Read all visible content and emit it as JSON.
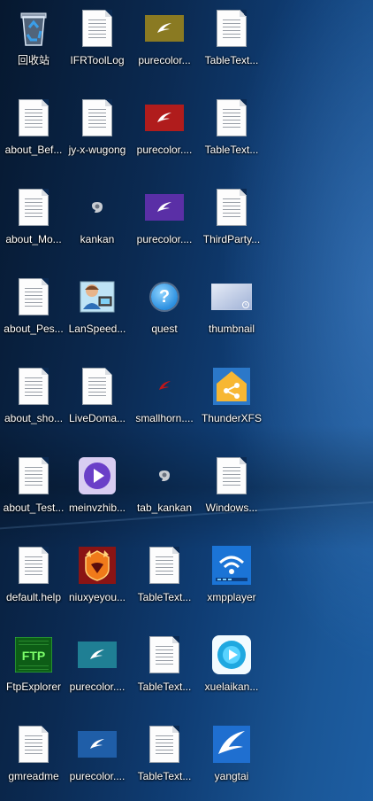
{
  "desktop": {
    "icons": [
      {
        "label": "回收站",
        "icon": "recycle-bin-icon"
      },
      {
        "label": "IFRToolLog",
        "icon": "document-icon"
      },
      {
        "label": "purecolor...",
        "icon": "purecolor-olive-icon"
      },
      {
        "label": "TableText...",
        "icon": "document-icon"
      },
      {
        "label": "about_Bef...",
        "icon": "document-icon"
      },
      {
        "label": "jy-x-wugong",
        "icon": "document-icon"
      },
      {
        "label": "purecolor....",
        "icon": "purecolor-red-icon"
      },
      {
        "label": "TableText...",
        "icon": "document-icon"
      },
      {
        "label": "about_Mo...",
        "icon": "document-icon"
      },
      {
        "label": "kankan",
        "icon": "kankan-icon"
      },
      {
        "label": "purecolor....",
        "icon": "purecolor-purple-icon"
      },
      {
        "label": "ThirdParty...",
        "icon": "document-icon"
      },
      {
        "label": "about_Pes...",
        "icon": "document-icon"
      },
      {
        "label": "LanSpeed...",
        "icon": "lanspeed-icon"
      },
      {
        "label": "quest",
        "icon": "question-icon"
      },
      {
        "label": "thumbnail",
        "icon": "thumbnail-icon"
      },
      {
        "label": "about_sho...",
        "icon": "document-icon"
      },
      {
        "label": "LiveDoma...",
        "icon": "document-icon"
      },
      {
        "label": "smallhorn....",
        "icon": "smallhorn-icon"
      },
      {
        "label": "ThunderXFS",
        "icon": "thunderxfs-icon"
      },
      {
        "label": "about_Test...",
        "icon": "document-icon"
      },
      {
        "label": "meinvzhib...",
        "icon": "video-player-icon"
      },
      {
        "label": "tab_kankan",
        "icon": "kankan-icon"
      },
      {
        "label": "Windows...",
        "icon": "document-icon"
      },
      {
        "label": "default.help",
        "icon": "document-icon"
      },
      {
        "label": "niuxyeyou...",
        "icon": "niuxyeyou-icon"
      },
      {
        "label": "TableText...",
        "icon": "document-icon"
      },
      {
        "label": "xmpplayer",
        "icon": "xmpplayer-icon"
      },
      {
        "label": "FtpExplorer",
        "icon": "ftp-icon"
      },
      {
        "label": "purecolor....",
        "icon": "purecolor-teal-icon"
      },
      {
        "label": "TableText...",
        "icon": "document-icon"
      },
      {
        "label": "xuelaikan...",
        "icon": "xuelaikan-icon"
      },
      {
        "label": "gmreadme",
        "icon": "document-icon"
      },
      {
        "label": "purecolor....",
        "icon": "purecolor-blue-icon"
      },
      {
        "label": "TableText...",
        "icon": "document-icon"
      },
      {
        "label": "yangtai",
        "icon": "yangtai-icon"
      }
    ]
  },
  "colors": {
    "olive": "#8a7a22",
    "red": "#b01c1c",
    "purple": "#5a2fa6",
    "teal": "#1f7f94",
    "blue": "#1f5ea8"
  }
}
